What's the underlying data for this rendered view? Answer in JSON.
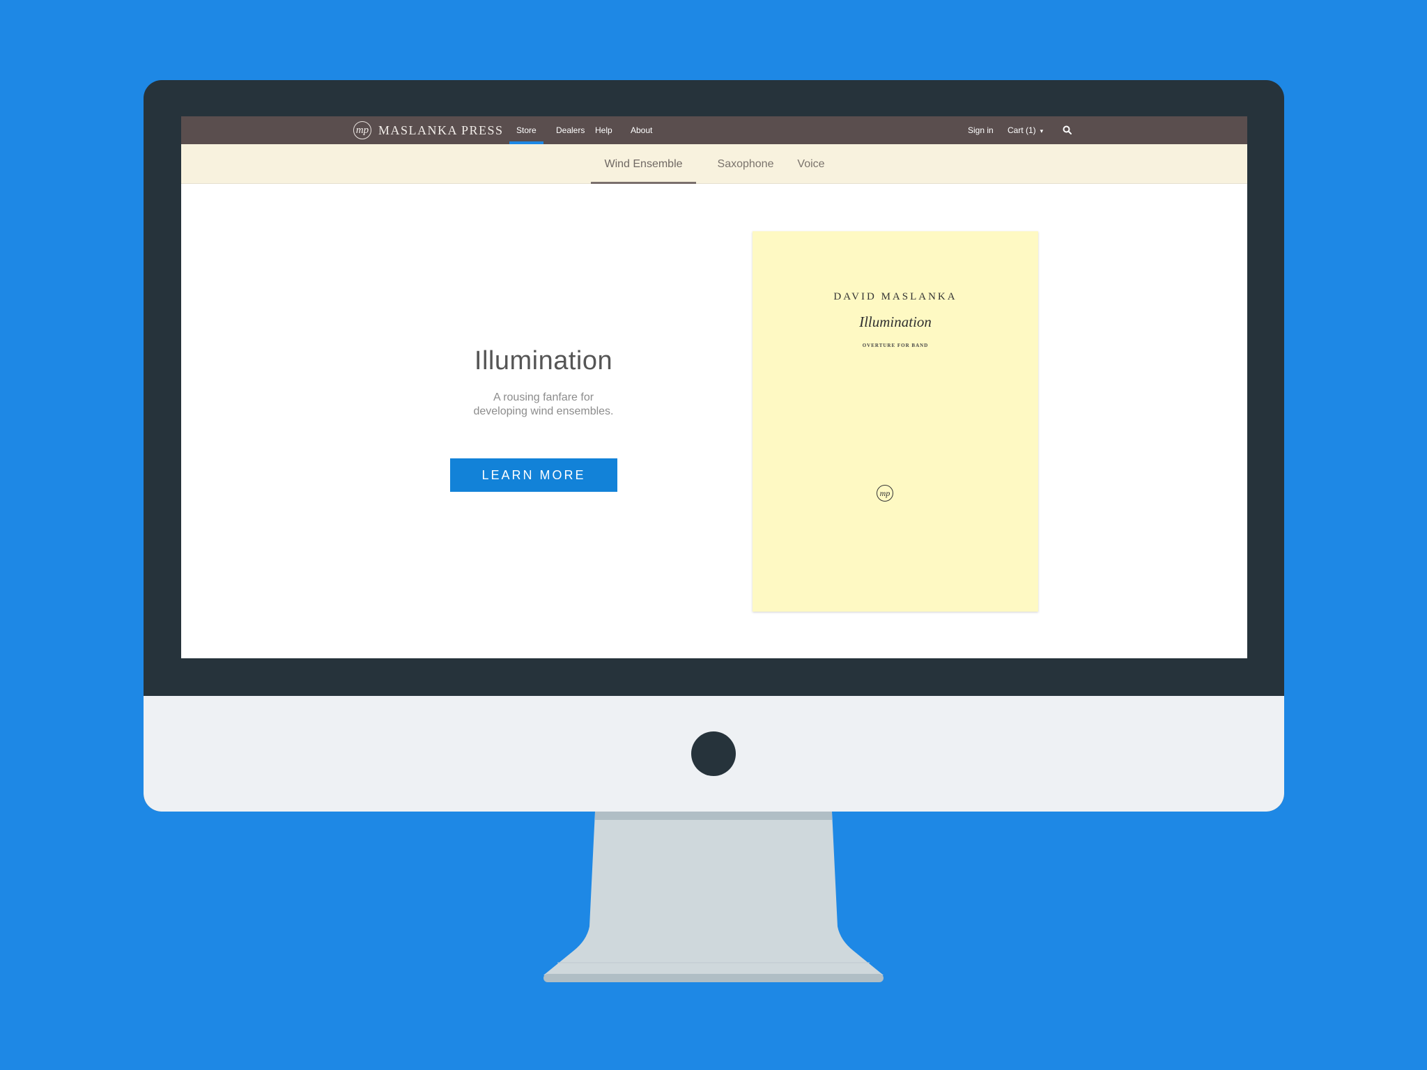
{
  "brand": {
    "mark": "mp",
    "name": "MASLANKA PRESS"
  },
  "topnav": {
    "items": [
      {
        "label": "Store",
        "active": true
      },
      {
        "label": "Dealers"
      },
      {
        "label": "Help"
      },
      {
        "label": "About"
      }
    ],
    "signin": "Sign in",
    "cart": "Cart (1)",
    "cart_caret": "▾"
  },
  "subnav": {
    "tabs": [
      {
        "label": "Wind Ensemble",
        "active": true
      },
      {
        "label": "Saxophone"
      },
      {
        "label": "Voice"
      }
    ]
  },
  "hero": {
    "title": "Illumination",
    "subtitle_line1": "A rousing fanfare for",
    "subtitle_line2": "developing wind ensembles.",
    "cta": "LEARN MORE"
  },
  "cover": {
    "composer": "DAVID MASLANKA",
    "title": "Illumination",
    "subtitle": "OVERTURE FOR BAND",
    "logo": "mp"
  },
  "colors": {
    "background": "#1e88e5",
    "topnav": "#5a4e4e",
    "subnav": "#f8f2de",
    "accent": "#1282d8",
    "cover": "#fef9c3"
  }
}
